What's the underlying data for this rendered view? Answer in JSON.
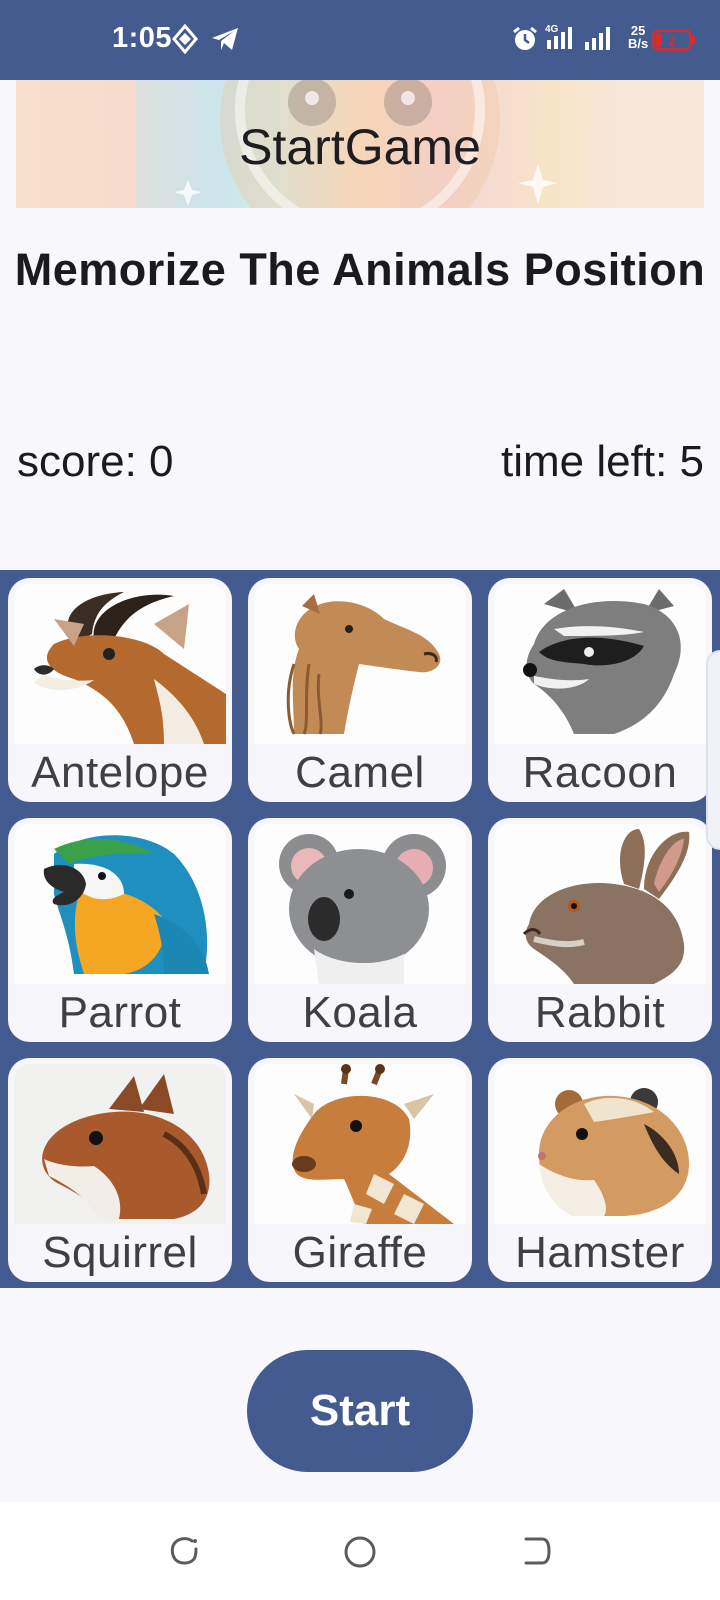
{
  "status_bar": {
    "time": "1:05",
    "network_type": "4G",
    "speed_value": "25",
    "speed_unit": "B/s",
    "battery_level": "2",
    "icons": [
      "navigation-diamond-icon",
      "telegram-icon",
      "alarm-icon",
      "signal-4g-icon",
      "signal-icon",
      "battery-low-icon"
    ]
  },
  "header": {
    "title": "StartGame"
  },
  "game": {
    "heading": "Memorize The Animals Position",
    "score": "score: 0",
    "time_left": "time left: 5"
  },
  "cards": [
    {
      "label": "Antelope",
      "icon": "antelope-image"
    },
    {
      "label": "Camel",
      "icon": "camel-image"
    },
    {
      "label": "Racoon",
      "icon": "racoon-image"
    },
    {
      "label": "Parrot",
      "icon": "parrot-image"
    },
    {
      "label": "Koala",
      "icon": "koala-image"
    },
    {
      "label": "Rabbit",
      "icon": "rabbit-image"
    },
    {
      "label": "Squirrel",
      "icon": "squirrel-image"
    },
    {
      "label": "Giraffe",
      "icon": "giraffe-image"
    },
    {
      "label": "Hamster",
      "icon": "hamster-image"
    }
  ],
  "start_button": {
    "label": "Start"
  },
  "nav_bar": {
    "icons": [
      "recent-apps-icon",
      "home-icon",
      "back-icon"
    ]
  },
  "colors": {
    "primary": "#435b8f",
    "background": "#f8f7fc",
    "card": "#f7f7fb",
    "battery_warning": "#e0292c"
  }
}
